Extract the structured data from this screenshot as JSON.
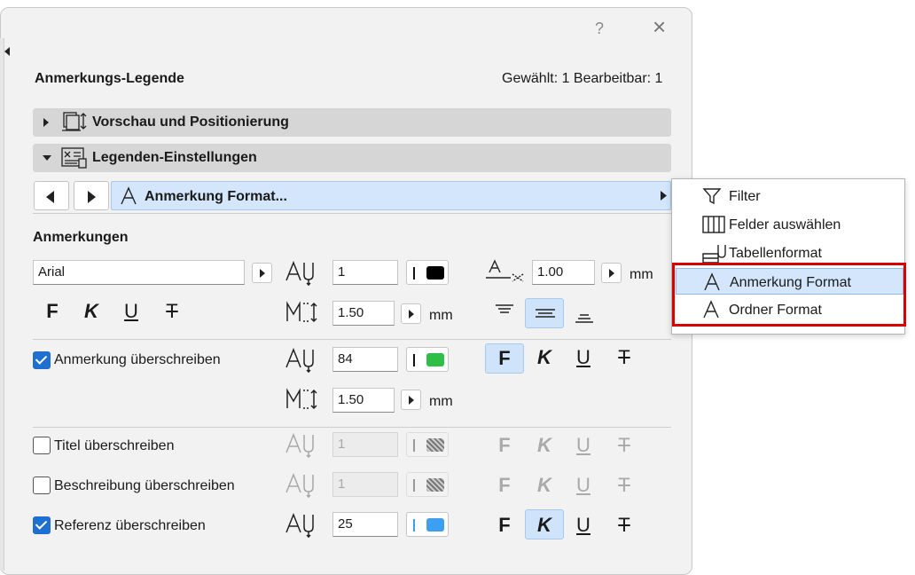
{
  "window": {
    "help_label": "?",
    "close_label": "×",
    "title": "Anmerkungs-Legende",
    "selection_status": "Gewählt: 1 Bearbeitbar: 1"
  },
  "sections": {
    "preview": "Vorschau und Positionierung",
    "legend_settings": "Legenden-Einstellungen"
  },
  "format_bar": {
    "label": "Anmerkung Format..."
  },
  "annotations": {
    "heading": "Anmerkungen",
    "font": "Arial",
    "pen_value": "1",
    "spacing_value": "1.00",
    "spacing_unit": "mm",
    "line_height_value": "1.50",
    "line_height_unit": "mm",
    "style_glyphs": {
      "bold": "F",
      "italic": "K",
      "underline": "U",
      "strike": "T"
    }
  },
  "override": {
    "label": "Anmerkung überschreiben",
    "checked": true,
    "pen_value": "84",
    "line_height_value": "1.50",
    "unit": "mm"
  },
  "title_override": {
    "label": "Titel überschreiben",
    "checked": false,
    "pen_value": "1"
  },
  "description_override": {
    "label": "Beschreibung überschreiben",
    "checked": false,
    "pen_value": "1"
  },
  "reference_override": {
    "label": "Referenz überschreiben",
    "checked": true,
    "pen_value": "25"
  },
  "colors": {
    "accent": "#1f6fd0",
    "selection_bg": "#d3e6fb",
    "highlight_red": "#d90000",
    "pen_black": "#000000",
    "pen_green": "#2fbf47",
    "pen_blue": "#3d9ff2"
  },
  "dropdown_menu": {
    "items": [
      {
        "label": "Filter",
        "icon": "filter-icon"
      },
      {
        "label": "Felder auswählen",
        "icon": "columns-icon"
      },
      {
        "label": "Tabellenformat",
        "icon": "table-format-icon"
      },
      {
        "label": "Anmerkung Format",
        "icon": "text-format-icon",
        "highlighted": true
      },
      {
        "label": "Ordner Format",
        "icon": "text-format-icon"
      }
    ]
  }
}
